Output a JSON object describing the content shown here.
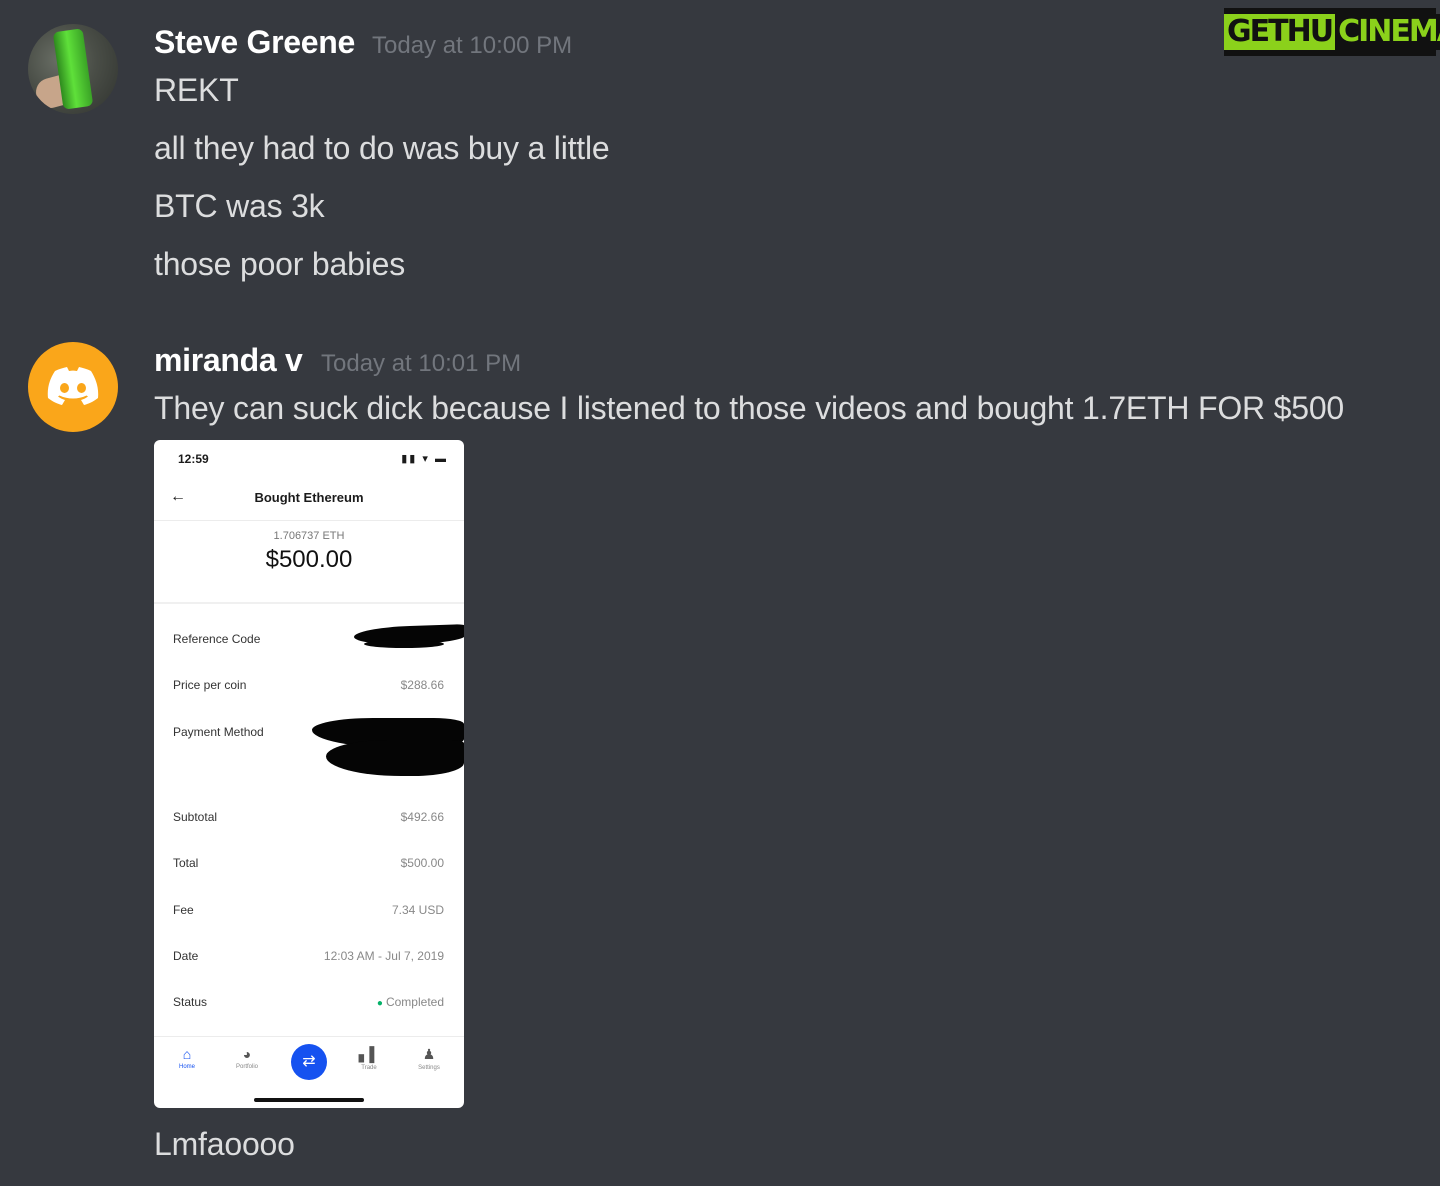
{
  "watermark": {
    "left": "GETHU",
    "right": "CINEMA"
  },
  "messages": [
    {
      "username": "Steve Greene",
      "timestamp": "Today at 10:00 PM",
      "lines": [
        "REKT",
        "all they had to do was buy a little",
        "BTC was 3k",
        "those poor babies"
      ]
    },
    {
      "username": "miranda v",
      "timestamp": "Today at 10:01 PM",
      "lines": [
        "They can suck dick because I listened to those videos and bought 1.7ETH FOR $500"
      ],
      "after_attachment": "Lmfaoooo"
    }
  ],
  "attachment": {
    "status_time": "12:59",
    "status_icons": "▮▮ ▾ ▬",
    "back_icon": "←",
    "title": "Bought Ethereum",
    "eth_amount": "1.706737 ETH",
    "usd_amount": "$500.00",
    "rows": [
      {
        "label": "Reference Code",
        "value": ""
      },
      {
        "label": "Price per coin",
        "value": "$288.66"
      },
      {
        "label": "Payment Method",
        "value": ""
      },
      {
        "label": "Subtotal",
        "value": "$492.66"
      },
      {
        "label": "Total",
        "value": "$500.00"
      },
      {
        "label": "Fee",
        "value": "7.34 USD"
      },
      {
        "label": "Date",
        "value": "12:03 AM - Jul 7, 2019"
      },
      {
        "label": "Status",
        "value": "Completed"
      }
    ],
    "nav": [
      {
        "label": "Home",
        "icon": "⌂"
      },
      {
        "label": "Portfolio",
        "icon": "◕"
      },
      {
        "label": "Trade",
        "icon": "⇄"
      },
      {
        "label": "Trade",
        "icon": "▖▌"
      },
      {
        "label": "Settings",
        "icon": "♟"
      }
    ]
  }
}
